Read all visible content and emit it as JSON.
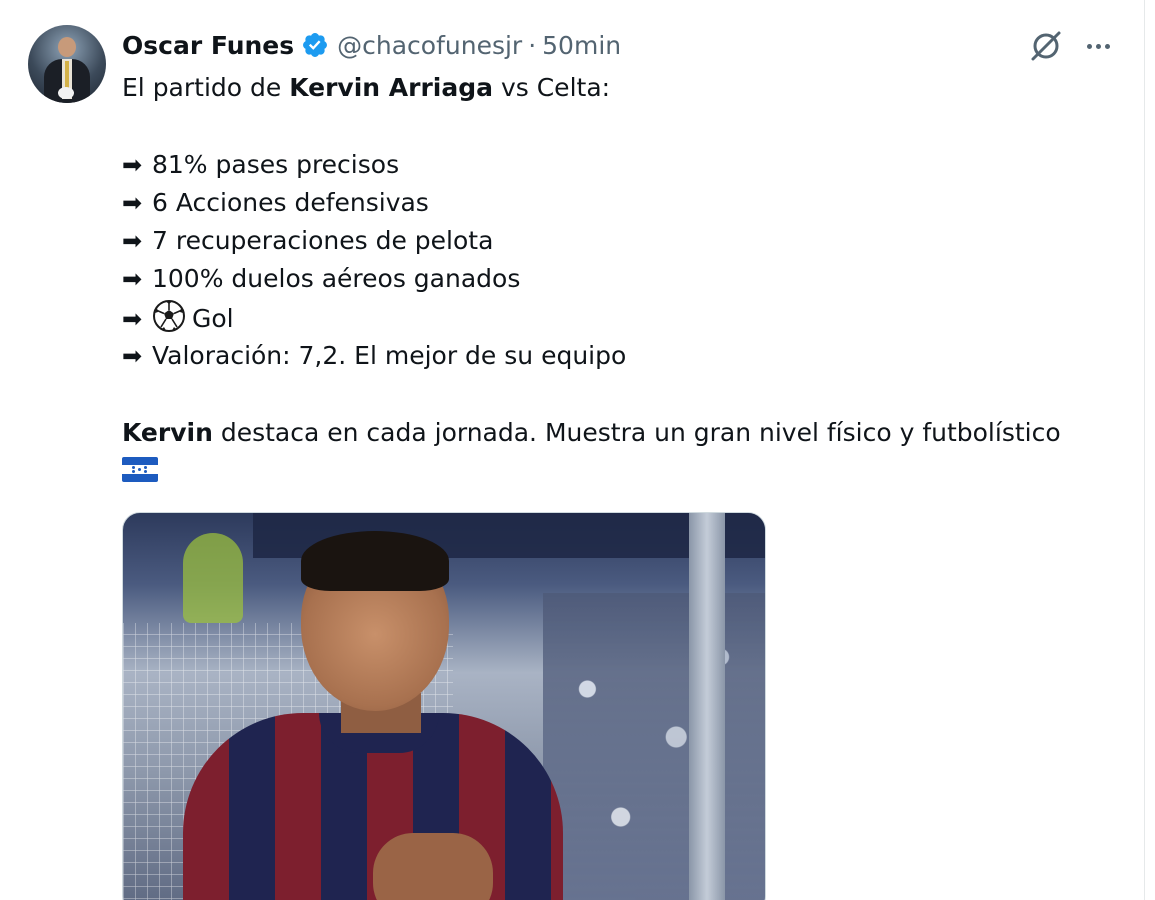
{
  "tweet": {
    "author_name": "Oscar Funes",
    "handle": "@chacofunesjr",
    "separator": "·",
    "time": "50min",
    "intro_plain": "El partido de ",
    "intro_bold": "Kervin Arriaga",
    "intro_tail": " vs Celta:",
    "arrow": "➡",
    "stats": [
      "81% pases precisos",
      "6 Acciones defensivas",
      "7 recuperaciones de pelota",
      "100% duelos aéreos ganados",
      "Gol",
      "Valoración: 7,2. El mejor de su equipo"
    ],
    "closing_bold": "Kervin",
    "closing_text": " destaca en cada jornada. Muestra un gran nivel físico y futbolístico",
    "icons": {
      "verified": "verified-badge-icon",
      "grok": "grok-icon",
      "more": "more-icon",
      "soccer": "soccer-ball-emoji",
      "flag": "honduras-flag-emoji"
    },
    "colors": {
      "verified": "#1d9bf0",
      "muted": "#536471",
      "text": "#0f1419"
    }
  }
}
